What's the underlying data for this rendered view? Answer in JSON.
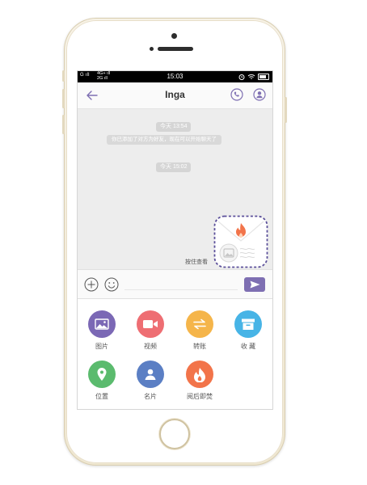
{
  "status_bar": {
    "network_left": "G ıll",
    "network_mid": "4G+ ıll\n2G ıll",
    "time": "15:03"
  },
  "header": {
    "back_icon": "back-arrow-icon",
    "title": "Inga",
    "call_icon": "phone-icon",
    "profile_icon": "user-icon"
  },
  "chat": {
    "time_badge_1": "今天 13:54",
    "system_message": "你已添加了对方为好友，现在可以开始聊天了",
    "time_badge_2": "今天 15:02",
    "burn_message_label": "按住查看",
    "burn_message_icon": "burn-envelope-icon"
  },
  "input_bar": {
    "plus_icon": "plus-circle-icon",
    "emoji_icon": "emoji-icon",
    "send_icon": "send-icon"
  },
  "panel": {
    "items": [
      {
        "label": "图片",
        "icon": "image-icon",
        "color": "#7b68b5"
      },
      {
        "label": "视频",
        "icon": "video-icon",
        "color": "#ee6e73"
      },
      {
        "label": "转账",
        "icon": "transfer-icon",
        "color": "#f5b54a"
      },
      {
        "label": "收 藏",
        "icon": "box-icon",
        "color": "#47b4e6"
      },
      {
        "label": "位置",
        "icon": "location-icon",
        "color": "#5bbb6e"
      },
      {
        "label": "名片",
        "icon": "contact-card-icon",
        "color": "#5b7fc4"
      },
      {
        "label": "阅后即焚",
        "icon": "fire-icon",
        "color": "#f2744a"
      }
    ]
  }
}
